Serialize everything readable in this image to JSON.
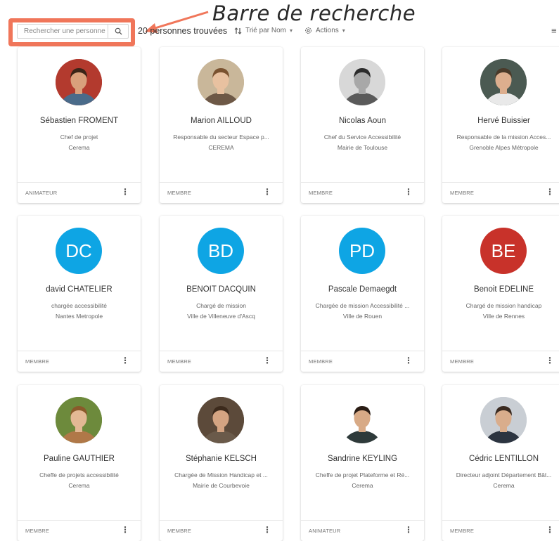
{
  "annotation": {
    "title": "Barre de recherche"
  },
  "toolbar": {
    "search_placeholder": "Rechercher une personne",
    "count_text": "20 personnes trouvées",
    "sort_label": "Trié par Nom",
    "actions_label": "Actions",
    "icons": {
      "search": "search-icon",
      "sort": "sort-icon",
      "actions": "gear-icon",
      "menu": "menu-icon"
    }
  },
  "people": [
    {
      "name": "Sébastien FROMENT",
      "line1": "Chef de projet",
      "line2": "Cerema",
      "role": "ANIMATEUR",
      "avatar": {
        "type": "photo",
        "bg": "#b33a2e",
        "skin": "#d9a07c",
        "hair": "#3a2418",
        "shirt": "#4a6b8a"
      }
    },
    {
      "name": "Marion AILLOUD",
      "line1": "Responsable du secteur Espace p...",
      "line2": "CEREMA",
      "role": "MEMBRE",
      "avatar": {
        "type": "photo",
        "bg": "#c9b79a",
        "skin": "#e8c1a0",
        "hair": "#7a5230",
        "shirt": "#6d5846"
      }
    },
    {
      "name": "Nicolas Aoun",
      "line1": "Chef du Service Accessibilité",
      "line2": "Mairie de Toulouse",
      "role": "MEMBRE",
      "avatar": {
        "type": "photo",
        "bg": "#d8d8d8",
        "skin": "#a8a8a8",
        "hair": "#2c2c2c",
        "shirt": "#5a5a5a"
      }
    },
    {
      "name": "Hervé Buissier",
      "line1": "Responsable de la mission Acces...",
      "line2": "Grenoble Alpes Métropole",
      "role": "MEMBRE",
      "avatar": {
        "type": "photo",
        "bg": "#4b5a52",
        "skin": "#dcae8e",
        "hair": "#4a3a2a",
        "shirt": "#e9e9e9"
      }
    },
    {
      "name": "david CHATELIER",
      "line1": "chargée accessibilité",
      "line2": "Nantes Metropole",
      "role": "MEMBRE",
      "avatar": {
        "type": "initials",
        "initials": "DC",
        "bg": "#0ea5e4"
      }
    },
    {
      "name": "BENOIT DACQUIN",
      "line1": "Chargé de mission",
      "line2": "Ville de Villeneuve d'Ascq",
      "role": "MEMBRE",
      "avatar": {
        "type": "initials",
        "initials": "BD",
        "bg": "#0ea5e4"
      }
    },
    {
      "name": "Pascale Demaegdt",
      "line1": "Chargée de mission Accessibilité ...",
      "line2": "Ville de Rouen",
      "role": "MEMBRE",
      "avatar": {
        "type": "initials",
        "initials": "PD",
        "bg": "#0ea5e4"
      }
    },
    {
      "name": "Benoit EDELINE",
      "line1": "Chargé de mission handicap",
      "line2": "Ville de Rennes",
      "role": "MEMBRE",
      "avatar": {
        "type": "initials",
        "initials": "BE",
        "bg": "#c8322a"
      }
    },
    {
      "name": "Pauline GAUTHIER",
      "line1": "Cheffe de projets accessibilité",
      "line2": "Cerema",
      "role": "MEMBRE",
      "avatar": {
        "type": "photo",
        "bg": "#6d8a3c",
        "skin": "#e3b894",
        "hair": "#8a5a2a",
        "shirt": "#b07848"
      }
    },
    {
      "name": "Stéphanie KELSCH",
      "line1": "Chargée de Mission Handicap et ...",
      "line2": "Mairie de Courbevoie",
      "role": "MEMBRE",
      "avatar": {
        "type": "photo",
        "bg": "#5c4a3a",
        "skin": "#d4a482",
        "hair": "#3c2a1c",
        "shirt": "#6a5a4a"
      }
    },
    {
      "name": "Sandrine KEYLING",
      "line1": "Cheffe de projet Plateforme et Ré...",
      "line2": "Cerema",
      "role": "ANIMATEUR",
      "avatar": {
        "type": "photo",
        "bg": "#ffffff",
        "skin": "#d8aa86",
        "hair": "#2a1c14",
        "shirt": "#2e3a3a"
      }
    },
    {
      "name": "Cédric LENTILLON",
      "line1": "Directeur adjoint Département Bât...",
      "line2": "Cerema",
      "role": "MEMBRE",
      "avatar": {
        "type": "photo",
        "bg": "#c9ced4",
        "skin": "#d9ad8c",
        "hair": "#3a2a20",
        "shirt": "#2c3440"
      }
    }
  ]
}
